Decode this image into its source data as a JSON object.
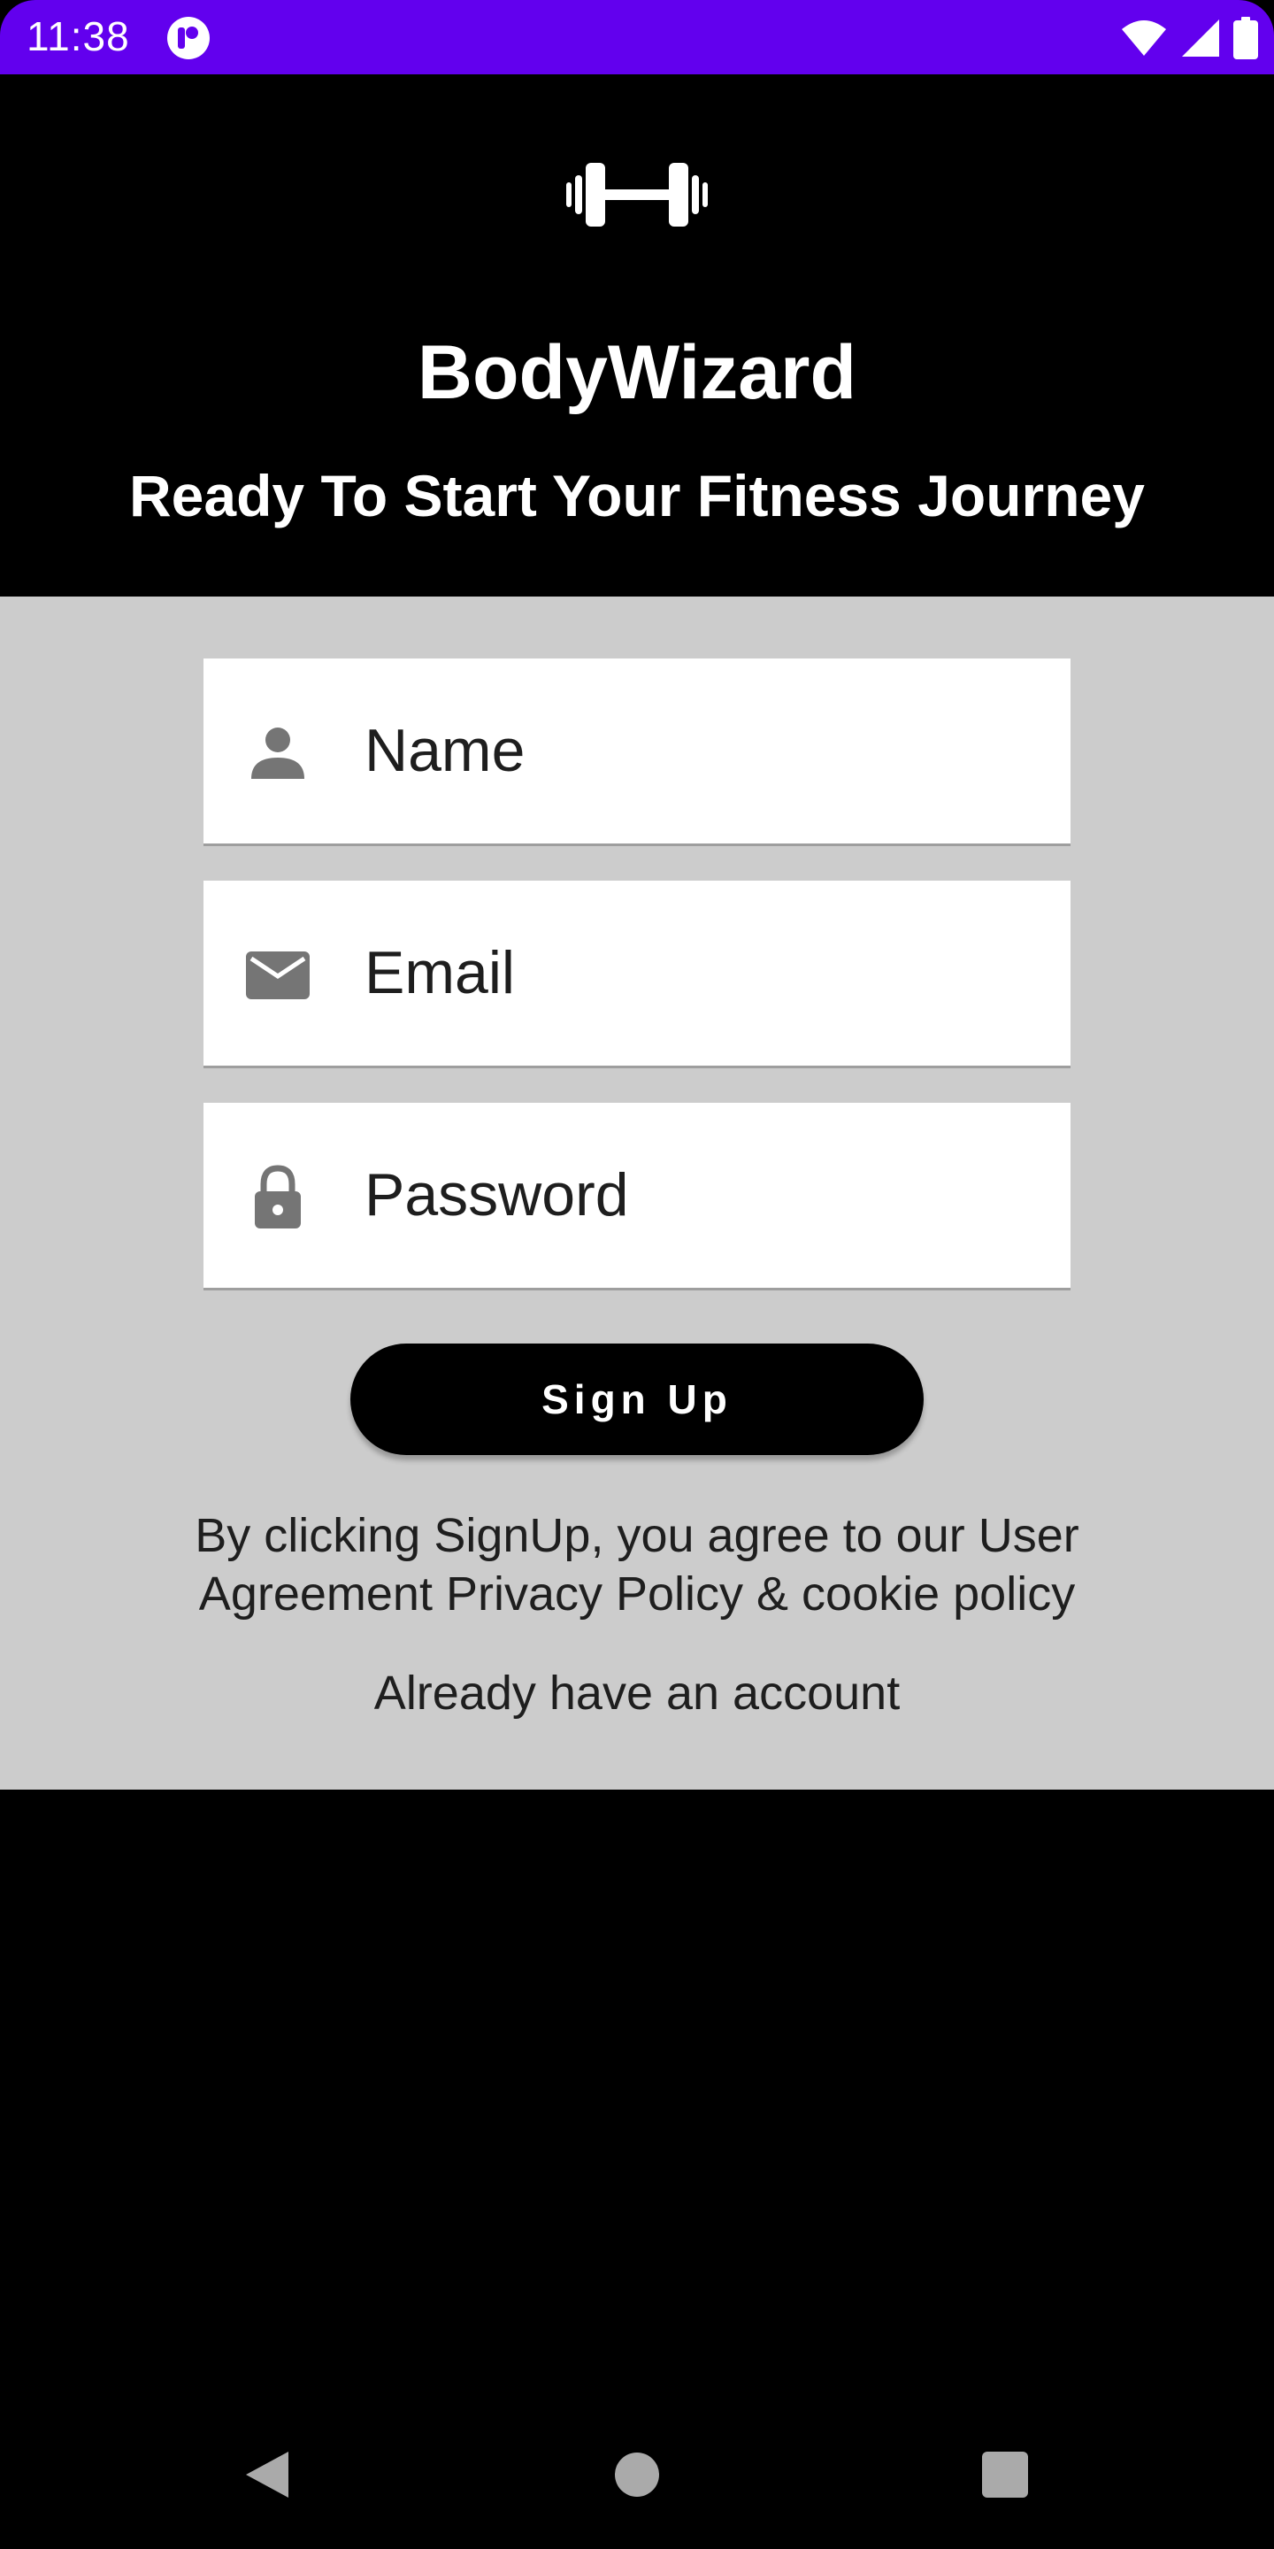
{
  "status_bar": {
    "time": "11:38",
    "color": "#6200ee",
    "icons": [
      "app-notification-icon",
      "wifi-icon",
      "signal-icon",
      "battery-icon"
    ]
  },
  "header": {
    "logo_icon": "dumbbell-icon",
    "title": "BodyWizard",
    "tagline": "Ready To Start Your Fitness Journey"
  },
  "form": {
    "name_field": {
      "placeholder": "Name",
      "value": "",
      "icon": "person-icon"
    },
    "email_field": {
      "placeholder": "Email",
      "value": "",
      "icon": "mail-icon"
    },
    "password_field": {
      "placeholder": "Password",
      "value": "",
      "icon": "lock-icon"
    },
    "signup_label": "Sign Up",
    "agreement_text": "By clicking SignUp, you agree to our User Agreement Privacy Policy  & cookie policy",
    "login_link": "Already have an account"
  },
  "nav_bar": {
    "back": "back-icon",
    "home": "home-icon",
    "recents": "recents-icon"
  }
}
